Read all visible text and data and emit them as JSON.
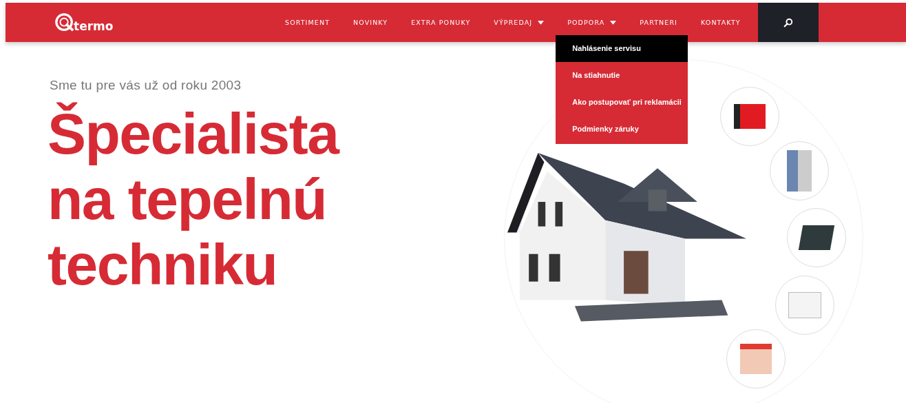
{
  "logo": {
    "text": "termo"
  },
  "nav": [
    {
      "label": "SORTIMENT",
      "has_dropdown": false
    },
    {
      "label": "NOVINKY",
      "has_dropdown": false
    },
    {
      "label": "EXTRA PONUKY",
      "has_dropdown": false
    },
    {
      "label": "VÝPREDAJ",
      "has_dropdown": true
    },
    {
      "label": "PODPORA",
      "has_dropdown": true,
      "menu": [
        {
          "label": "Nahlásenie servisu",
          "selected": true
        },
        {
          "label": "Na stiahnutie",
          "selected": false
        },
        {
          "label": "Ako postupovať pri reklamácii",
          "selected": false
        },
        {
          "label": "Podmienky záruky",
          "selected": false
        }
      ]
    },
    {
      "label": "PARTNERI",
      "has_dropdown": false
    },
    {
      "label": "KONTAKTY",
      "has_dropdown": false
    }
  ],
  "hero": {
    "tagline": "Sme tu pre vás už od roku 2003",
    "heading_lines": [
      "Špecialista",
      "na tepelnú",
      "techniku"
    ]
  }
}
